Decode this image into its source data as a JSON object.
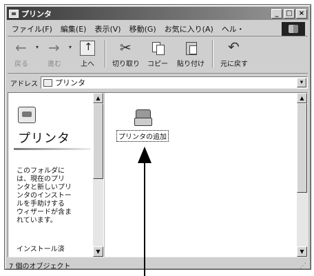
{
  "window": {
    "title": "プリンタ"
  },
  "title_buttons": {
    "minimize": "_",
    "maximize": "□",
    "close": "×"
  },
  "menu": [
    "ファイル(F)",
    "編集(E)",
    "表示(V)",
    "移動(G)",
    "お気に入り(A)",
    "ヘル・"
  ],
  "toolbar": {
    "back": "戻る",
    "forward": "進む",
    "up": "上へ",
    "cut": "切り取り",
    "copy": "コピー",
    "paste": "貼り付け",
    "undo": "元に戻す",
    "dropdown_glyph": "▾"
  },
  "address": {
    "label": "アドレス",
    "value": "プリンタ",
    "dropdown_glyph": "▾"
  },
  "left_pane": {
    "title": "プリンタ",
    "description": "このフォルダに\nは、現在のプリ\nンタと新しいプリ\nンタのインストー\nルを手助けする\nウィザードが含ま\nれています。",
    "more": "インストール済"
  },
  "items": [
    {
      "label": "プリンタの追加",
      "icon": "add-printer-icon"
    }
  ],
  "scroll_glyphs": {
    "up": "▲",
    "down": "▼"
  },
  "status": {
    "text": "7 個のオブジェクト",
    "grip": "⋰"
  },
  "colors": {
    "titlebar_start": "#3a3a3a",
    "titlebar_end": "#9a9a9a",
    "face": "#cfcfcf"
  }
}
